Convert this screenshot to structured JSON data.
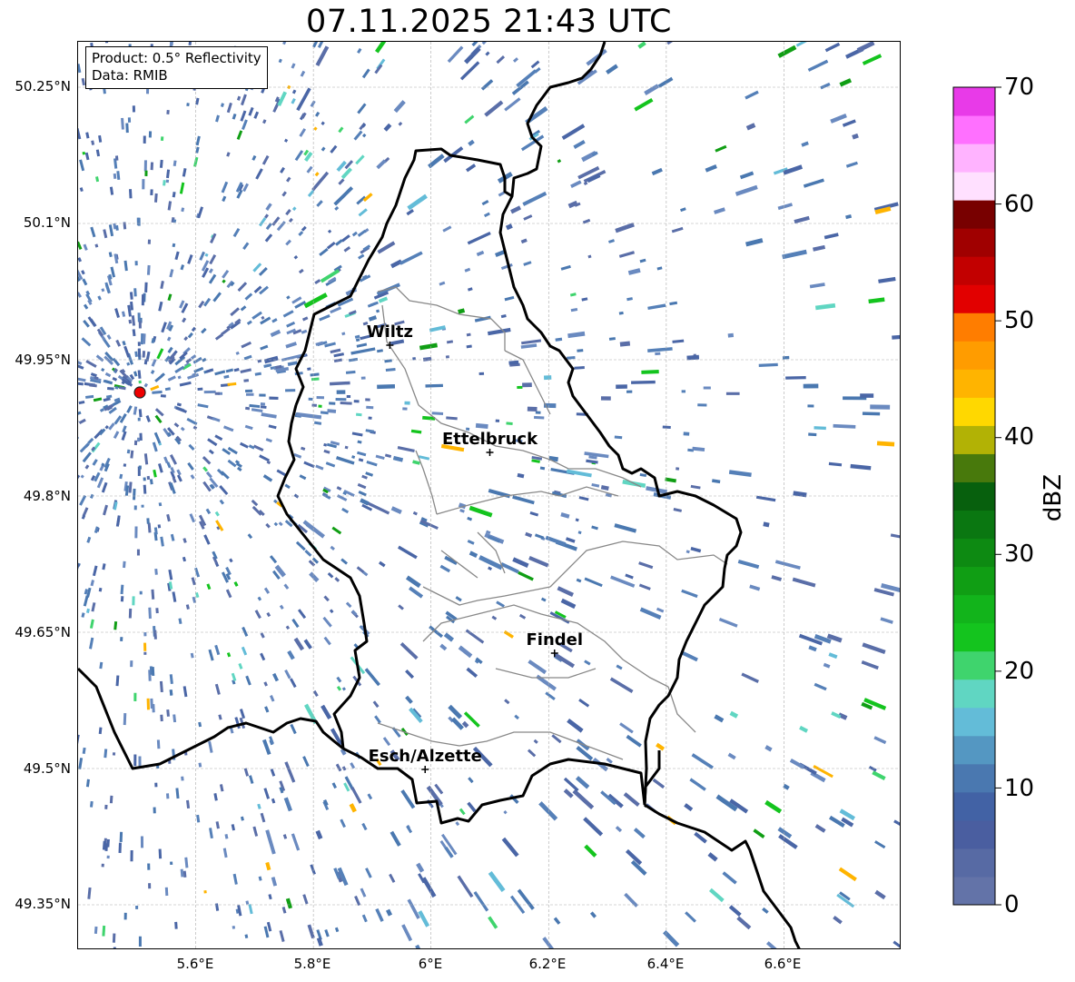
{
  "title": "07.11.2025 21:43 UTC",
  "info": {
    "product": "Product: 0.5° Reflectivity",
    "data": "Data: RMIB"
  },
  "axes": {
    "lat_ticks": [
      "50.25°N",
      "50.1°N",
      "49.95°N",
      "49.8°N",
      "49.65°N",
      "49.5°N",
      "49.35°N"
    ],
    "lon_ticks": [
      "5.6°E",
      "5.8°E",
      "6°E",
      "6.2°E",
      "6.4°E",
      "6.6°E"
    ]
  },
  "cities": [
    {
      "name": "Wiltz",
      "lon": 5.93,
      "lat": 49.966
    },
    {
      "name": "Ettelbruck",
      "lon": 6.1,
      "lat": 49.848
    },
    {
      "name": "Findel",
      "lon": 6.21,
      "lat": 49.627
    },
    {
      "name": "Esch/Alzette",
      "lon": 5.99,
      "lat": 49.499
    }
  ],
  "radar_site": {
    "lon": 5.505,
    "lat": 49.914
  },
  "colorbar": {
    "label": "dBZ",
    "ticks": [
      "70",
      "60",
      "50",
      "40",
      "30",
      "20",
      "10",
      "0"
    ],
    "colors": [
      "#6373a8",
      "#576aa4",
      "#4a5ea0",
      "#4262a5",
      "#4a78b0",
      "#5497c2",
      "#63bcd8",
      "#60d6c2",
      "#3fd46d",
      "#14c41e",
      "#12b41b",
      "#109e14",
      "#0d8a12",
      "#0a7711",
      "#07600d",
      "#48790c",
      "#b2b205",
      "#ffd800",
      "#ffb400",
      "#ff9c00",
      "#ff7d00",
      "#e20000",
      "#c20000",
      "#a00000",
      "#780000",
      "#ffe0ff",
      "#ffb3ff",
      "#ff70ff",
      "#e83ae8"
    ]
  }
}
